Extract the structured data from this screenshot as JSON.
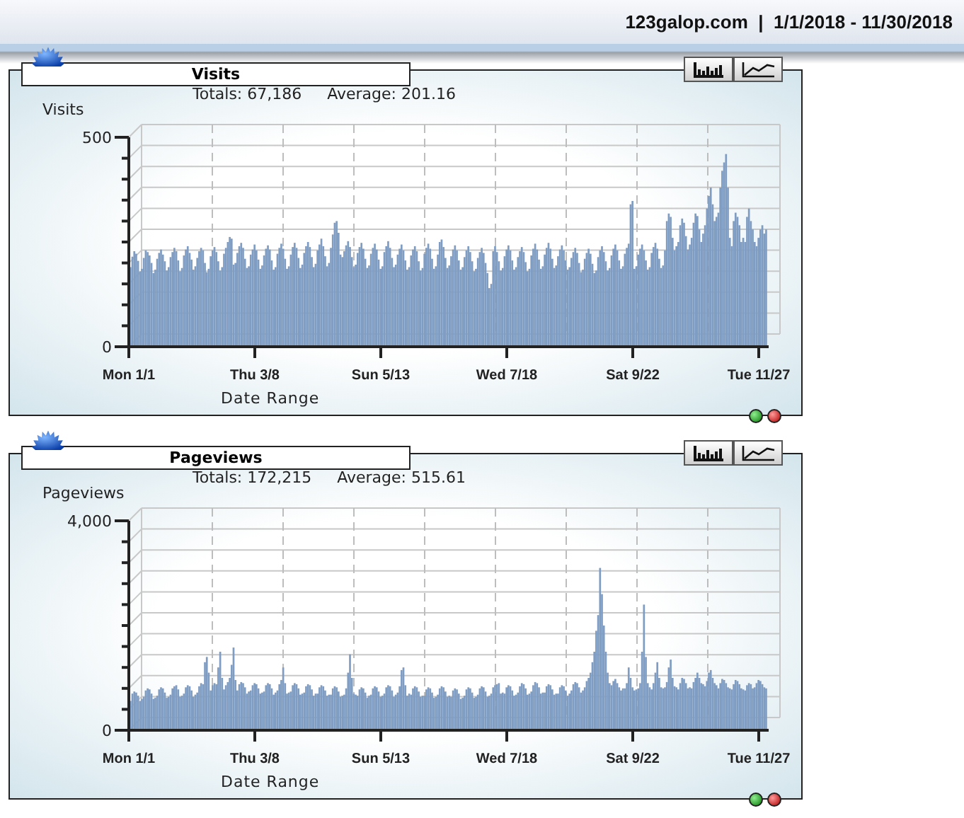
{
  "header": {
    "text": "123galop.com  |  1/1/2018 - 11/30/2018"
  },
  "panels": [
    {
      "title": "Visits",
      "totals": "Totals: 67,186",
      "average": "Average: 201.16",
      "chart_data": {
        "type": "bar",
        "ylabel": "Visits",
        "xlabel": "Date Range",
        "ylim": [
          0,
          500
        ],
        "yticks": [
          0,
          500
        ],
        "categories": [
          "Mon 1/1",
          null,
          null,
          null,
          null,
          null,
          null,
          null,
          null,
          null,
          null,
          null,
          null,
          null,
          null,
          null,
          null,
          null,
          null,
          null,
          null,
          null,
          null,
          null,
          null,
          null,
          null,
          null,
          null,
          null,
          null,
          null,
          null,
          null,
          null,
          null,
          null,
          null,
          null,
          null,
          null,
          null,
          null,
          null,
          null,
          null,
          null,
          null,
          null,
          null,
          null,
          null,
          null,
          null,
          null,
          null,
          null,
          null,
          null,
          null,
          null,
          null,
          null,
          null,
          null,
          null,
          "Thu 3/8",
          null,
          null,
          null,
          null,
          null,
          null,
          null,
          null,
          null,
          null,
          null,
          null,
          null,
          null,
          null,
          null,
          null,
          null,
          null,
          null,
          null,
          null,
          null,
          null,
          null,
          null,
          null,
          null,
          null,
          null,
          null,
          null,
          null,
          null,
          null,
          null,
          null,
          null,
          null,
          null,
          null,
          null,
          null,
          null,
          null,
          null,
          null,
          null,
          null,
          null,
          null,
          null,
          null,
          null,
          null,
          null,
          null,
          null,
          null,
          null,
          null,
          null,
          null,
          null,
          null,
          "Sun 5/13",
          null,
          null,
          null,
          null,
          null,
          null,
          null,
          null,
          null,
          null,
          null,
          null,
          null,
          null,
          null,
          null,
          null,
          null,
          null,
          null,
          null,
          null,
          null,
          null,
          null,
          null,
          null,
          null,
          null,
          null,
          null,
          null,
          null,
          null,
          null,
          null,
          null,
          null,
          null,
          null,
          null,
          null,
          null,
          null,
          null,
          null,
          null,
          null,
          null,
          null,
          null,
          null,
          null,
          null,
          null,
          null,
          null,
          null,
          null,
          null,
          null,
          null,
          null,
          null,
          null,
          "Wed 7/18",
          null,
          null,
          null,
          null,
          null,
          null,
          null,
          null,
          null,
          null,
          null,
          null,
          null,
          null,
          null,
          null,
          null,
          null,
          null,
          null,
          null,
          null,
          null,
          null,
          null,
          null,
          null,
          null,
          null,
          null,
          null,
          null,
          null,
          null,
          null,
          null,
          null,
          null,
          null,
          null,
          null,
          null,
          null,
          null,
          null,
          null,
          null,
          null,
          null,
          null,
          null,
          null,
          null,
          null,
          null,
          null,
          null,
          null,
          null,
          null,
          null,
          null,
          null,
          null,
          null,
          "Sat 9/22",
          null,
          null,
          null,
          null,
          null,
          null,
          null,
          null,
          null,
          null,
          null,
          null,
          null,
          null,
          null,
          null,
          null,
          null,
          null,
          null,
          null,
          null,
          null,
          null,
          null,
          null,
          null,
          null,
          null,
          null,
          null,
          null,
          null,
          null,
          null,
          null,
          null,
          null,
          null,
          null,
          null,
          null,
          null,
          null,
          null,
          null,
          null,
          null,
          null,
          null,
          null,
          null,
          null,
          null,
          null,
          null,
          null,
          null,
          null,
          null,
          null,
          null,
          null,
          null,
          null,
          "Tue 11/27",
          null,
          null,
          null
        ],
        "values": [
          190,
          215,
          228,
          222,
          205,
          180,
          186,
          212,
          230,
          226,
          218,
          200,
          176,
          184,
          210,
          224,
          232,
          220,
          204,
          182,
          190,
          214,
          226,
          236,
          228,
          206,
          180,
          188,
          218,
          232,
          240,
          224,
          208,
          184,
          192,
          212,
          228,
          236,
          230,
          200,
          178,
          186,
          216,
          230,
          238,
          226,
          204,
          182,
          190,
          222,
          236,
          250,
          262,
          258,
          196,
          200,
          224,
          240,
          248,
          236,
          210,
          188,
          192,
          220,
          232,
          244,
          230,
          208,
          186,
          194,
          218,
          234,
          242,
          232,
          206,
          184,
          190,
          222,
          236,
          246,
          234,
          210,
          186,
          192,
          220,
          238,
          248,
          236,
          212,
          188,
          196,
          224,
          240,
          250,
          238,
          214,
          190,
          198,
          230,
          244,
          258,
          240,
          216,
          192,
          200,
          236,
          268,
          296,
          300,
          272,
          220,
          214,
          228,
          242,
          252,
          238,
          214,
          190,
          196,
          224,
          238,
          248,
          234,
          210,
          188,
          194,
          222,
          236,
          246,
          232,
          208,
          186,
          192,
          226,
          240,
          252,
          236,
          212,
          190,
          196,
          220,
          234,
          244,
          230,
          206,
          184,
          190,
          218,
          232,
          240,
          228,
          204,
          182,
          188,
          222,
          236,
          246,
          234,
          210,
          186,
          192,
          220,
          250,
          256,
          238,
          212,
          188,
          194,
          216,
          232,
          242,
          230,
          206,
          184,
          190,
          214,
          230,
          240,
          226,
          204,
          180,
          186,
          212,
          226,
          236,
          224,
          200,
          176,
          140,
          150,
          228,
          240,
          226,
          204,
          182,
          188,
          216,
          232,
          242,
          230,
          206,
          184,
          190,
          214,
          228,
          238,
          226,
          202,
          180,
          186,
          218,
          234,
          246,
          232,
          208,
          186,
          192,
          220,
          236,
          248,
          234,
          210,
          188,
          194,
          216,
          232,
          242,
          230,
          206,
          184,
          190,
          212,
          226,
          236,
          224,
          200,
          178,
          184,
          210,
          224,
          234,
          222,
          198,
          176,
          182,
          214,
          230,
          240,
          226,
          204,
          182,
          188,
          218,
          234,
          244,
          230,
          206,
          186,
          192,
          222,
          236,
          246,
          340,
          348,
          186,
          192,
          220,
          234,
          244,
          230,
          206,
          184,
          190,
          224,
          238,
          248,
          234,
          210,
          188,
          194,
          230,
          300,
          318,
          310,
          260,
          230,
          240,
          250,
          290,
          306,
          296,
          264,
          232,
          244,
          260,
          296,
          318,
          312,
          280,
          250,
          270,
          290,
          330,
          360,
          380,
          340,
          300,
          310,
          320,
          380,
          420,
          440,
          460,
          380,
          260,
          240,
          300,
          320,
          310,
          290,
          250,
          260,
          250,
          310,
          330,
          300,
          280,
          250,
          240,
          260,
          280,
          290,
          270,
          280
        ]
      }
    },
    {
      "title": "Pageviews",
      "totals": "Totals: 172,215",
      "average": "Average: 515.61",
      "chart_data": {
        "type": "bar",
        "ylabel": "Pageviews",
        "xlabel": "Date Range",
        "ylim": [
          0,
          4000
        ],
        "yticks": [
          {
            "value": 0,
            "label": "0"
          },
          {
            "value": 4000,
            "label": "4,000"
          }
        ],
        "categories": [
          "Mon 1/1",
          null,
          null,
          null,
          null,
          null,
          null,
          null,
          null,
          null,
          null,
          null,
          null,
          null,
          null,
          null,
          null,
          null,
          null,
          null,
          null,
          null,
          null,
          null,
          null,
          null,
          null,
          null,
          null,
          null,
          null,
          null,
          null,
          null,
          null,
          null,
          null,
          null,
          null,
          null,
          null,
          null,
          null,
          null,
          null,
          null,
          null,
          null,
          null,
          null,
          null,
          null,
          null,
          null,
          null,
          null,
          null,
          null,
          null,
          null,
          null,
          null,
          null,
          null,
          null,
          null,
          "Thu 3/8",
          null,
          null,
          null,
          null,
          null,
          null,
          null,
          null,
          null,
          null,
          null,
          null,
          null,
          null,
          null,
          null,
          null,
          null,
          null,
          null,
          null,
          null,
          null,
          null,
          null,
          null,
          null,
          null,
          null,
          null,
          null,
          null,
          null,
          null,
          null,
          null,
          null,
          null,
          null,
          null,
          null,
          null,
          null,
          null,
          null,
          null,
          null,
          null,
          null,
          null,
          null,
          null,
          null,
          null,
          null,
          null,
          null,
          null,
          null,
          null,
          null,
          null,
          null,
          null,
          null,
          "Sun 5/13",
          null,
          null,
          null,
          null,
          null,
          null,
          null,
          null,
          null,
          null,
          null,
          null,
          null,
          null,
          null,
          null,
          null,
          null,
          null,
          null,
          null,
          null,
          null,
          null,
          null,
          null,
          null,
          null,
          null,
          null,
          null,
          null,
          null,
          null,
          null,
          null,
          null,
          null,
          null,
          null,
          null,
          null,
          null,
          null,
          null,
          null,
          null,
          null,
          null,
          null,
          null,
          null,
          null,
          null,
          null,
          null,
          null,
          null,
          null,
          null,
          null,
          null,
          null,
          null,
          null,
          "Wed 7/18",
          null,
          null,
          null,
          null,
          null,
          null,
          null,
          null,
          null,
          null,
          null,
          null,
          null,
          null,
          null,
          null,
          null,
          null,
          null,
          null,
          null,
          null,
          null,
          null,
          null,
          null,
          null,
          null,
          null,
          null,
          null,
          null,
          null,
          null,
          null,
          null,
          null,
          null,
          null,
          null,
          null,
          null,
          null,
          null,
          null,
          null,
          null,
          null,
          null,
          null,
          null,
          null,
          null,
          null,
          null,
          null,
          null,
          null,
          null,
          null,
          null,
          null,
          null,
          null,
          null,
          "Sat 9/22",
          null,
          null,
          null,
          null,
          null,
          null,
          null,
          null,
          null,
          null,
          null,
          null,
          null,
          null,
          null,
          null,
          null,
          null,
          null,
          null,
          null,
          null,
          null,
          null,
          null,
          null,
          null,
          null,
          null,
          null,
          null,
          null,
          null,
          null,
          null,
          null,
          null,
          null,
          null,
          null,
          null,
          null,
          null,
          null,
          null,
          null,
          null,
          null,
          null,
          null,
          null,
          null,
          null,
          null,
          null,
          null,
          null,
          null,
          null,
          null,
          null,
          null,
          null,
          null,
          null,
          "Tue 11/27",
          null,
          null,
          null
        ],
        "values": [
          560,
          700,
          740,
          720,
          660,
          560,
          600,
          640,
          760,
          800,
          780,
          700,
          600,
          620,
          660,
          780,
          820,
          800,
          720,
          620,
          640,
          680,
          800,
          840,
          860,
          780,
          640,
          660,
          700,
          820,
          860,
          840,
          760,
          640,
          680,
          720,
          840,
          900,
          880,
          1300,
          1400,
          1100,
          760,
          860,
          900,
          880,
          1200,
          1500,
          1000,
          780,
          860,
          920,
          1000,
          1250,
          1580,
          960,
          760,
          880,
          920,
          900,
          820,
          700,
          740,
          760,
          860,
          900,
          880,
          800,
          700,
          720,
          740,
          860,
          900,
          880,
          800,
          680,
          720,
          760,
          880,
          960,
          1200,
          900,
          700,
          720,
          740,
          860,
          900,
          880,
          800,
          680,
          700,
          720,
          840,
          880,
          860,
          780,
          660,
          700,
          700,
          820,
          860,
          840,
          760,
          660,
          680,
          680,
          800,
          840,
          820,
          740,
          640,
          660,
          680,
          800,
          1100,
          1450,
          1000,
          700,
          680,
          660,
          780,
          820,
          800,
          720,
          620,
          660,
          680,
          800,
          840,
          820,
          740,
          640,
          660,
          700,
          820,
          860,
          840,
          760,
          640,
          680,
          720,
          840,
          1150,
          1200,
          860,
          660,
          700,
          680,
          800,
          840,
          820,
          740,
          640,
          660,
          660,
          780,
          820,
          800,
          720,
          620,
          640,
          680,
          800,
          840,
          820,
          740,
          640,
          660,
          640,
          760,
          800,
          780,
          700,
          600,
          620,
          660,
          780,
          820,
          800,
          720,
          620,
          640,
          680,
          800,
          840,
          820,
          740,
          640,
          660,
          700,
          820,
          860,
          880,
          900,
          700,
          720,
          700,
          820,
          860,
          840,
          760,
          660,
          680,
          720,
          840,
          900,
          880,
          800,
          680,
          700,
          740,
          860,
          920,
          900,
          820,
          700,
          720,
          720,
          840,
          880,
          860,
          780,
          680,
          700,
          700,
          820,
          860,
          840,
          760,
          660,
          700,
          760,
          880,
          920,
          900,
          820,
          720,
          760,
          820,
          940,
          1000,
          1100,
          1300,
          1500,
          1900,
          2200,
          3100,
          2600,
          2000,
          1500,
          1100,
          900,
          860,
          940,
          980,
          900,
          820,
          760,
          800,
          800,
          900,
          1200,
          1000,
          820,
          760,
          780,
          800,
          900,
          1500,
          2400,
          1400,
          900,
          820,
          780,
          900,
          1100,
          1300,
          1000,
          820,
          800,
          820,
          920,
          1200,
          1350,
          1000,
          840,
          820,
          780,
          900,
          1000,
          980,
          900,
          800,
          820,
          800,
          920,
          1000,
          1100,
          1000,
          900,
          880,
          840,
          940,
          1100,
          1150,
          1000,
          900,
          860,
          800,
          900,
          980,
          960,
          900,
          820,
          800,
          780,
          880,
          960,
          940,
          880,
          800,
          780,
          760,
          860,
          900,
          880,
          800,
          820,
          900,
          960,
          940,
          880,
          820,
          800
        ]
      }
    }
  ]
}
